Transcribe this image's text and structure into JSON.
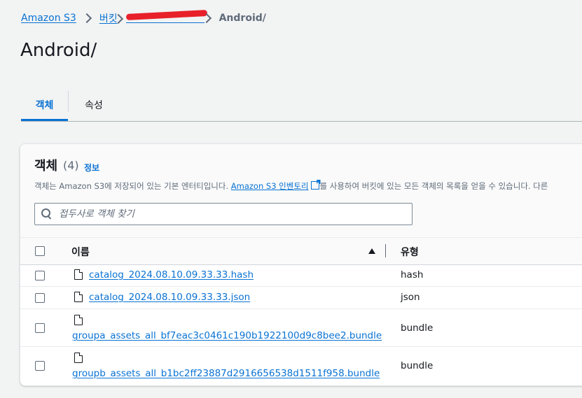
{
  "breadcrumb": {
    "root": "Amazon S3",
    "buckets": "버킷",
    "current": "Android/"
  },
  "page": {
    "title": "Android/"
  },
  "tabs": [
    {
      "label": "객체",
      "active": true
    },
    {
      "label": "속성",
      "active": false
    }
  ],
  "objects_panel": {
    "title": "객체",
    "count": "(4)",
    "info_label": "정보",
    "description_before": "객체는 Amazon S3에 저장되어 있는 기본 엔터티입니다. ",
    "description_link": "Amazon S3 인벤토리",
    "description_after": "를 사용하여 버킷에 있는 모든 객체의 목록을 얻을 수 있습니다. 다른"
  },
  "search": {
    "placeholder": "접두사로 객체 찾기",
    "value": ""
  },
  "table": {
    "columns": {
      "name": "이름",
      "type": "유형"
    },
    "rows": [
      {
        "name": "catalog_2024.08.10.09.33.33.hash",
        "type": "hash"
      },
      {
        "name": "catalog_2024.08.10.09.33.33.json",
        "type": "json"
      },
      {
        "name": "groupa_assets_all_bf7eac3c0461c190b1922100d9c8bee2.bundle",
        "type": "bundle"
      },
      {
        "name": "groupb_assets_all_b1bc2ff23887d2916656538d1511f958.bundle",
        "type": "bundle"
      }
    ]
  },
  "colors": {
    "link": "#0972d3",
    "text": "#16191f",
    "muted": "#5f6b7a",
    "background": "#f2f3f3",
    "redaction": "#e8202a"
  }
}
